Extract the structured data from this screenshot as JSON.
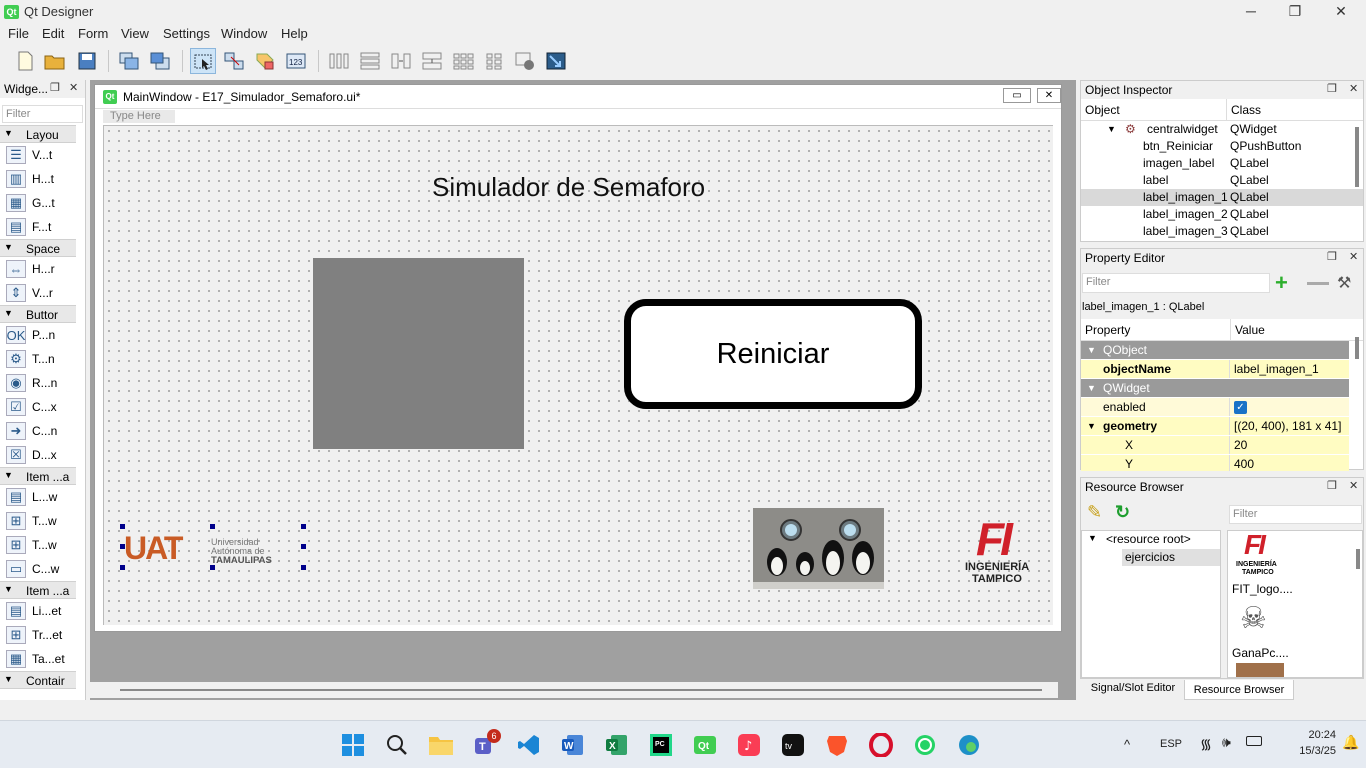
{
  "app": {
    "title": "Qt Designer",
    "icon_text": "Qt"
  },
  "menu": [
    "File",
    "Edit",
    "Form",
    "View",
    "Settings",
    "Window",
    "Help"
  ],
  "widget_box": {
    "title": "Widge...",
    "filter_placeholder": "Filter",
    "categories": [
      {
        "label": "Layou",
        "items": [
          "V...t",
          "H...t",
          "G...t",
          "F...t"
        ]
      },
      {
        "label": "Space",
        "items": [
          "H...r",
          "V...r"
        ]
      },
      {
        "label": "Buttor",
        "items": [
          "P...n",
          "T...n",
          "R...n",
          "C...x",
          "C...n",
          "D...x"
        ]
      },
      {
        "label": "Item ...a",
        "items": [
          "L...w",
          "T...w",
          "T...w",
          "C...w"
        ]
      },
      {
        "label": "Item ...a",
        "items": [
          "Li...et",
          "Tr...et",
          "Ta...et"
        ]
      },
      {
        "label": "Contair",
        "items": []
      }
    ]
  },
  "form": {
    "window_title": "MainWindow - E17_Simulador_Semaforo.ui*",
    "type_here": "Type Here",
    "heading": "Simulador de Semaforo",
    "button_label": "Reiniciar",
    "uat_logo": {
      "letters": "UAT",
      "line1": "Universidad",
      "line2": "Autónoma de",
      "line3": "TAMAULIPAS"
    },
    "fi_logo": {
      "letters": "FI",
      "line1": "INGENIERÍA",
      "line2": "TAMPICO"
    }
  },
  "object_inspector": {
    "title": "Object Inspector",
    "columns": [
      "Object",
      "Class"
    ],
    "rows": [
      {
        "object": "centralwidget",
        "class": "QWidget"
      },
      {
        "object": "btn_Reiniciar",
        "class": "QPushButton"
      },
      {
        "object": "imagen_label",
        "class": "QLabel"
      },
      {
        "object": "label",
        "class": "QLabel"
      },
      {
        "object": "label_imagen_1",
        "class": "QLabel"
      },
      {
        "object": "label_imagen_2",
        "class": "QLabel"
      },
      {
        "object": "label_imagen_3",
        "class": "QLabel"
      }
    ],
    "selected_index": 4
  },
  "property_editor": {
    "title": "Property Editor",
    "filter_placeholder": "Filter",
    "selection": "label_imagen_1 : QLabel",
    "columns": [
      "Property",
      "Value"
    ],
    "groups": {
      "qobject": "QObject",
      "qwidget": "QWidget"
    },
    "props": {
      "objectName": {
        "key": "objectName",
        "value": "label_imagen_1"
      },
      "enabled": {
        "key": "enabled",
        "value": true
      },
      "geometry": {
        "key": "geometry",
        "value": "[(20, 400), 181 x 41]"
      },
      "x": {
        "key": "X",
        "value": "20"
      },
      "y": {
        "key": "Y",
        "value": "400"
      }
    }
  },
  "resource_browser": {
    "title": "Resource Browser",
    "filter_placeholder": "Filter",
    "tree": [
      "<resource root>",
      "ejercicios"
    ],
    "files": [
      "FIT_logo....",
      "GanaPc...."
    ],
    "thumb_fi": {
      "letters": "FI",
      "line1": "INGENIERÍA",
      "line2": "TAMPICO"
    }
  },
  "bottom_tabs": [
    "Signal/Slot Editor",
    "Resource Browser"
  ],
  "taskbar": {
    "lang": "ESP",
    "time": "20:24",
    "date": "15/3/25",
    "teams_badge": "6"
  }
}
